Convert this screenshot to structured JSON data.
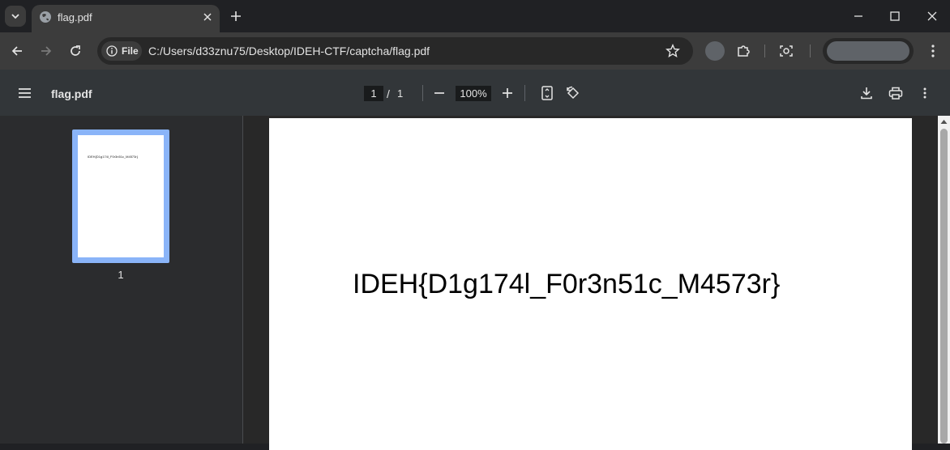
{
  "browser": {
    "tab": {
      "title": "flag.pdf"
    },
    "address": {
      "chip_label": "File",
      "url": "C:/Users/d33znu75/Desktop/IDEH-CTF/captcha/flag.pdf"
    }
  },
  "pdf_viewer": {
    "title": "flag.pdf",
    "current_page": "1",
    "page_separator": "/",
    "total_pages": "1",
    "zoom": "100%"
  },
  "sidebar": {
    "thumbnails": [
      {
        "label": "1",
        "preview_text": "IDEH{D1g174l_F0r3n51c_M4573r}"
      }
    ]
  },
  "document": {
    "text": "IDEH{D1g174l_F0r3n51c_M4573r}"
  },
  "colors": {
    "background": "#202124",
    "toolbar": "#3c3c3c",
    "pdf_toolbar": "#323639",
    "sidebar": "#2b2c2e",
    "thumbnail_selected": "#8ab4f8"
  },
  "icons": {
    "tab_search": "chevron-down-icon",
    "favicon": "globe-icon",
    "tab_close": "close-icon",
    "new_tab": "plus-icon",
    "minimize": "minimize-icon",
    "maximize": "maximize-icon",
    "close_window": "close-icon",
    "back": "arrow-left-icon",
    "forward": "arrow-right-icon",
    "reload": "reload-icon",
    "site_info": "info-icon",
    "bookmark": "star-icon",
    "extensions": "puzzle-icon",
    "lens": "lens-icon",
    "browser_menu": "kebab-icon",
    "sidebar_toggle": "hamburger-icon",
    "zoom_out": "minus-icon",
    "zoom_in": "plus-icon",
    "fit_page": "fit-page-icon",
    "rotate": "rotate-icon",
    "download": "download-icon",
    "print": "print-icon",
    "pdf_menu": "kebab-icon"
  }
}
